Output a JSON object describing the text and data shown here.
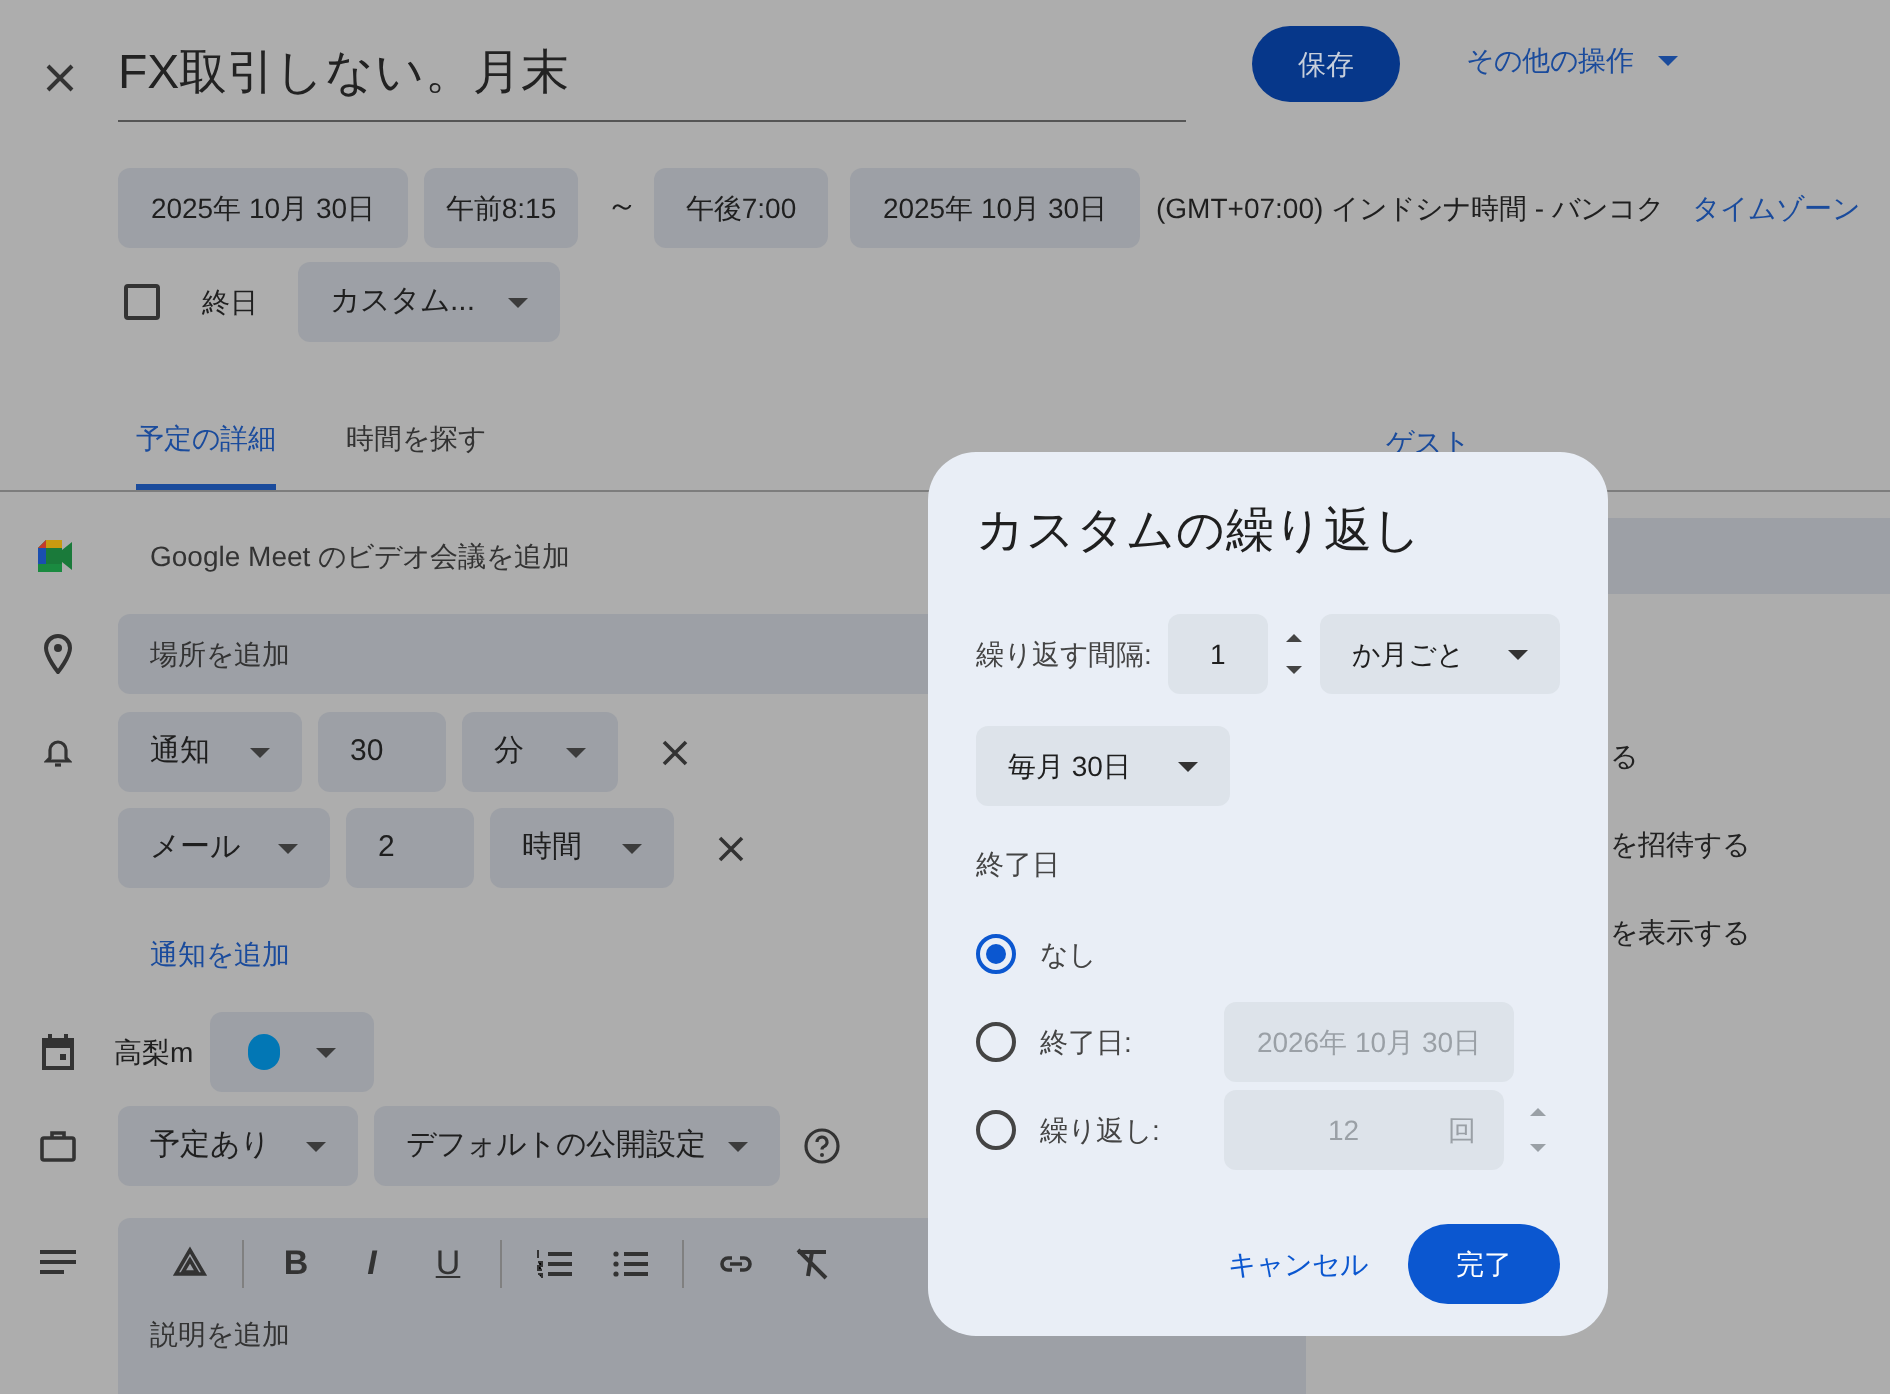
{
  "header": {
    "title": "FX取引しない。月末",
    "save": "保存",
    "more_actions": "その他の操作"
  },
  "datetime": {
    "start_date": "2025年 10月 30日",
    "start_time": "午前8:15",
    "separator": "～",
    "end_time": "午後7:00",
    "end_date": "2025年 10月 30日",
    "timezone": "(GMT+07:00) インドシナ時間 - バンコク",
    "timezone_link": "タイムゾーン"
  },
  "all_day": {
    "label": "終日",
    "checked": false
  },
  "recurrence": "カスタム...",
  "tabs": [
    {
      "label": "予定の詳細",
      "selected": true
    },
    {
      "label": "時間を探す",
      "selected": false
    }
  ],
  "guests_tab": "ゲスト",
  "meet": "Google Meet のビデオ会議を追加",
  "location_placeholder": "場所を追加",
  "notifications": [
    {
      "type": "通知",
      "value": "30",
      "unit": "分"
    },
    {
      "type": "メール",
      "value": "2",
      "unit": "時間"
    }
  ],
  "add_notification": "通知を追加",
  "calendar": {
    "owner": "高梨m",
    "color": "#0277b5"
  },
  "availability": "予定あり",
  "visibility": "デフォルトの公開設定",
  "description": {
    "toolbar": [
      {
        "kind": "drive"
      },
      {
        "kind": "divider"
      },
      {
        "kind": "bold",
        "label": "B"
      },
      {
        "kind": "italic",
        "label": "I"
      },
      {
        "kind": "underline",
        "label": "U"
      },
      {
        "kind": "divider"
      },
      {
        "kind": "numbered"
      },
      {
        "kind": "bulleted"
      },
      {
        "kind": "divider"
      },
      {
        "kind": "link"
      },
      {
        "kind": "clear"
      }
    ],
    "placeholder": "説明を追加"
  },
  "guest_options": [
    "る",
    "を招待する",
    "を表示する"
  ],
  "dialog": {
    "title": "カスタムの繰り返し",
    "interval_label": "繰り返す間隔:",
    "interval": "1",
    "unit": "か月ごと",
    "monthly": "毎月 30日",
    "ends_label": "終了日",
    "end_options": [
      {
        "kind": "never",
        "label": "なし",
        "selected": true
      },
      {
        "kind": "date",
        "label": "終了日:",
        "value": "2026年 10月 30日",
        "selected": false
      },
      {
        "kind": "count",
        "label": "繰り返し:",
        "value": "12",
        "suffix": "回",
        "selected": false
      }
    ],
    "cancel": "キャンセル",
    "done": "完了"
  }
}
